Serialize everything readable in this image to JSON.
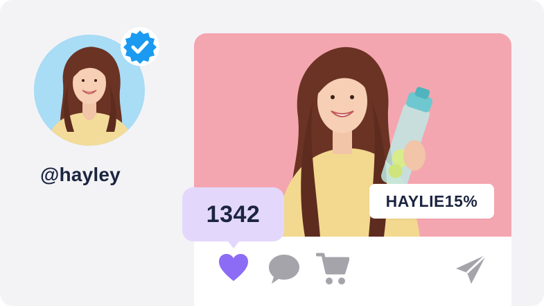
{
  "profile": {
    "username": "@hayley",
    "verified": true,
    "avatar_background": "#a9dcf5",
    "badge_color": "#1a9af0"
  },
  "post": {
    "photo_background": "#f4a6b0",
    "coupon_code": "HAYLIE15%",
    "like_count": "1342",
    "like_bubble_color": "#e3d8fc"
  },
  "actions": {
    "like_icon": "heart-icon",
    "like_color": "#8d6cf5",
    "comment_icon": "comment-icon",
    "cart_icon": "cart-icon",
    "share_icon": "send-icon",
    "icon_color": "#a4a4aa"
  }
}
